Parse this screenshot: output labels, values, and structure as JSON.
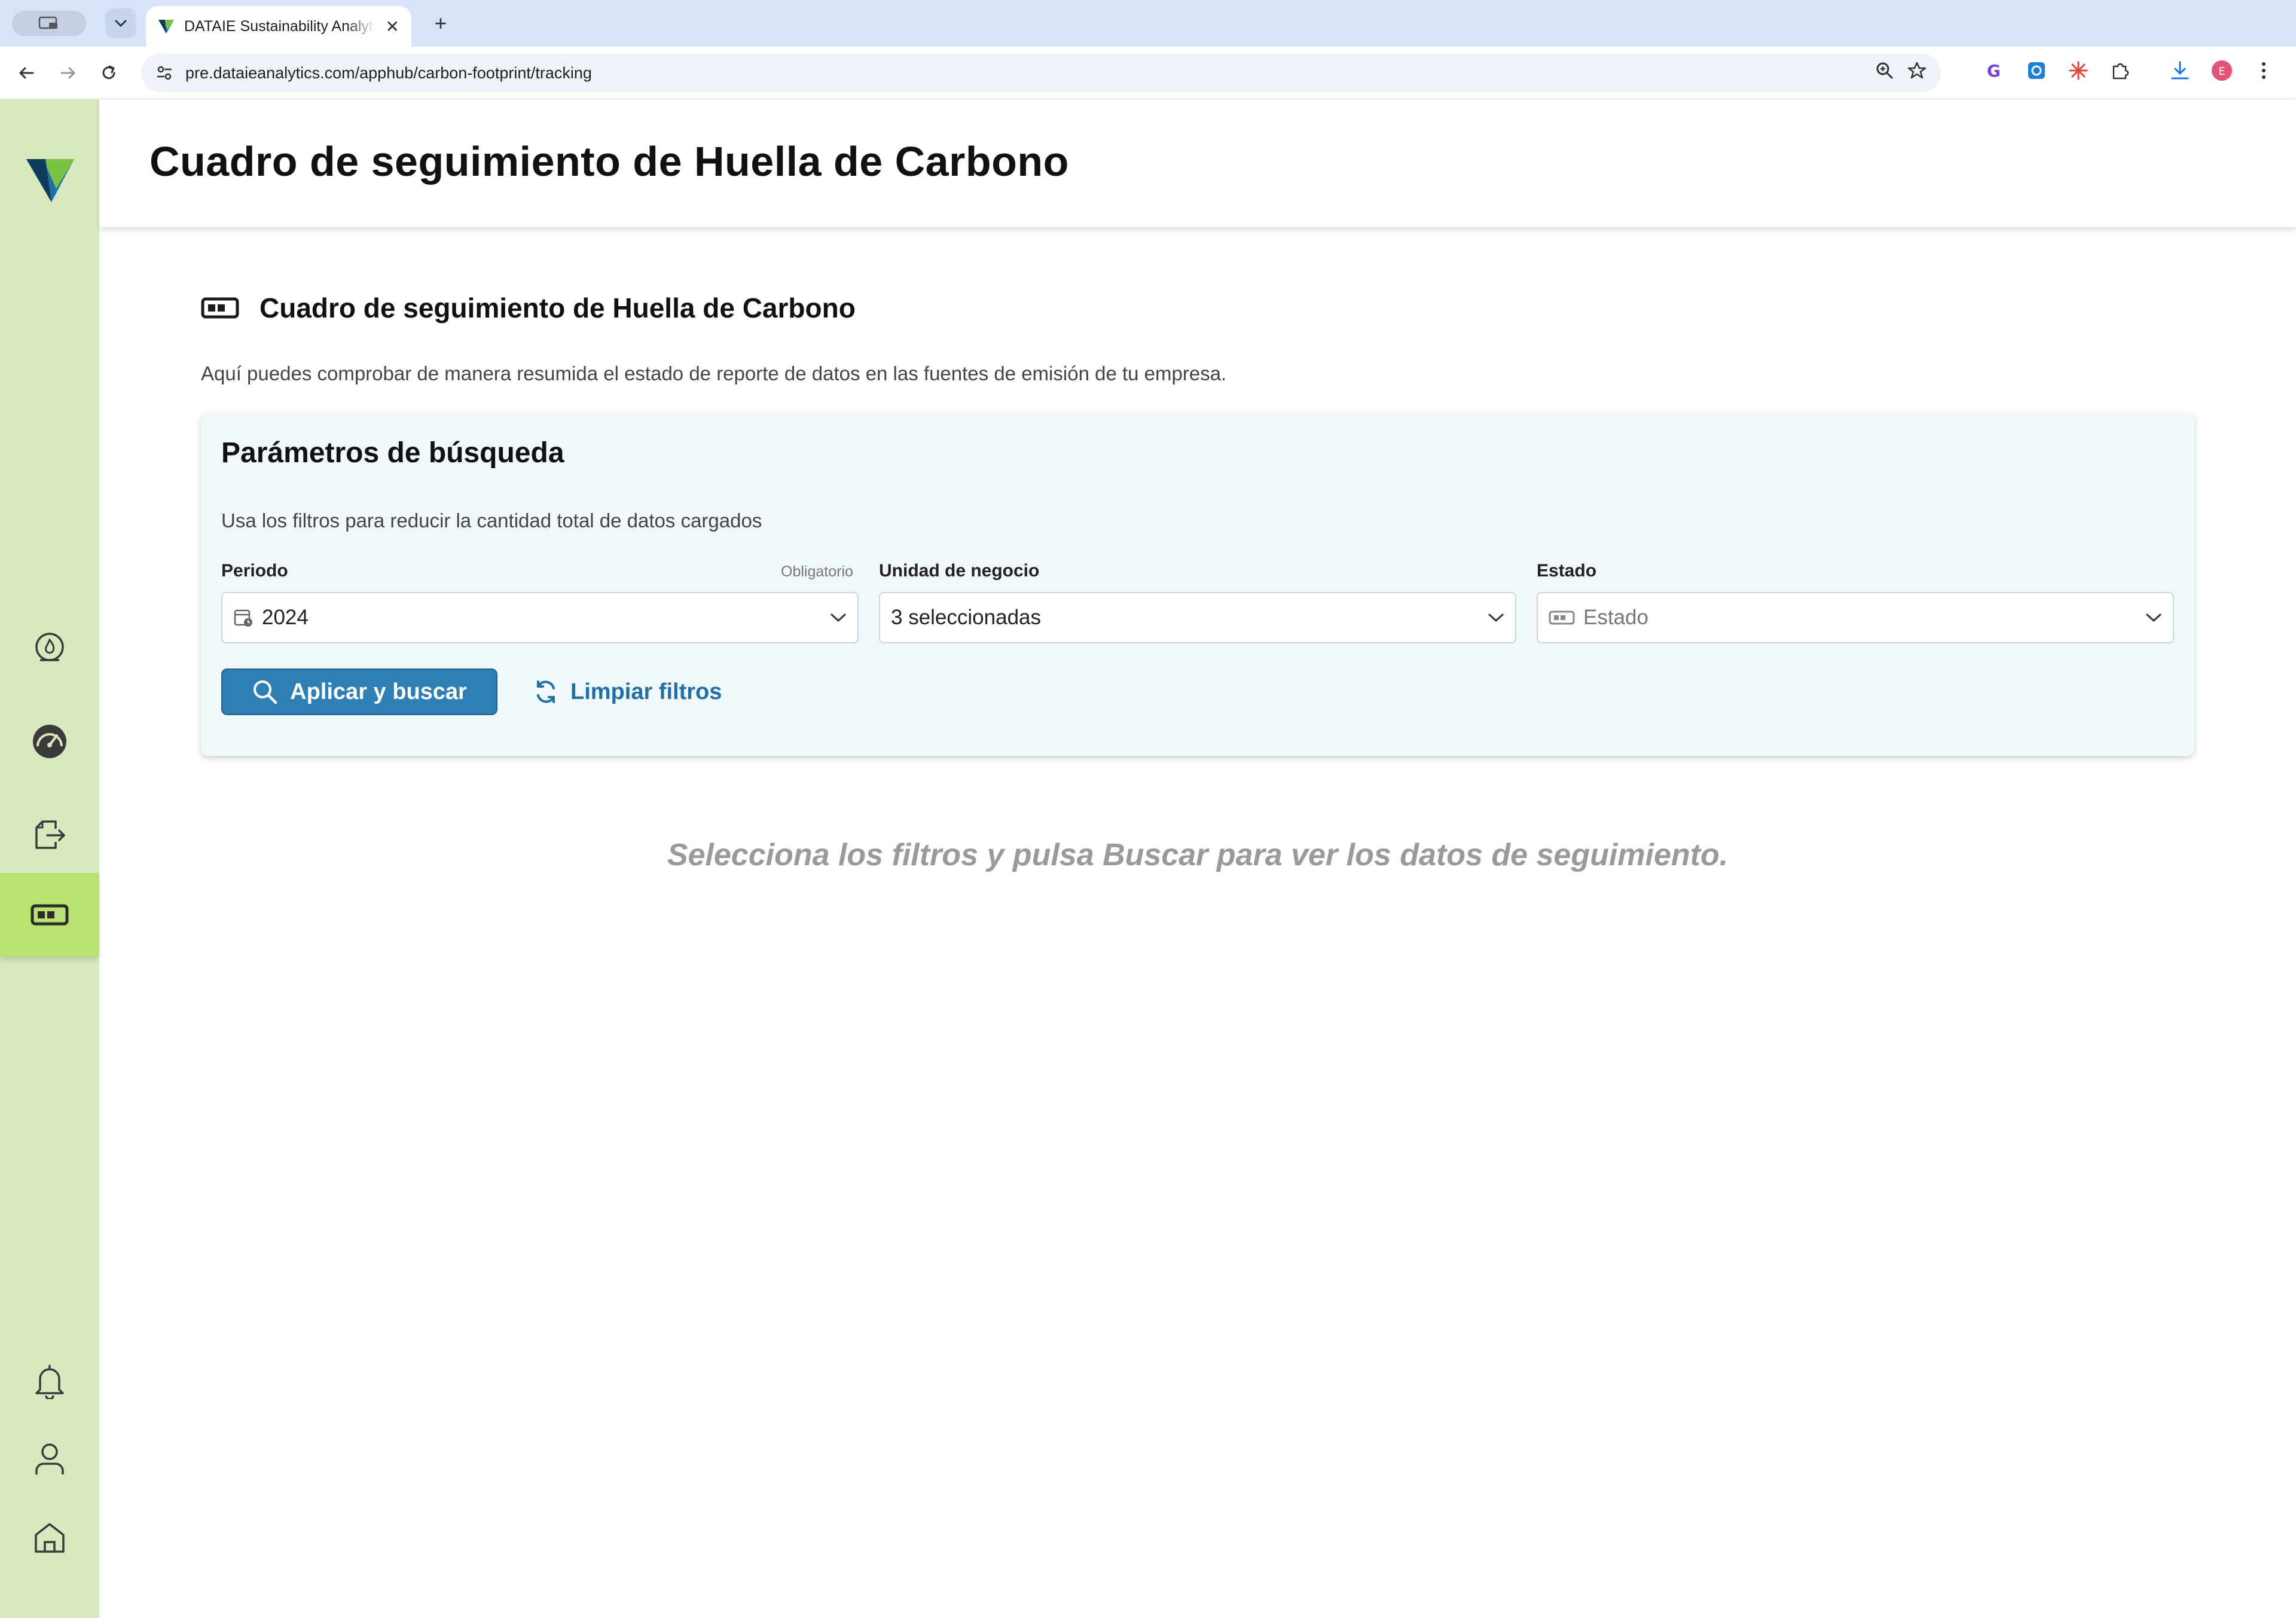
{
  "browser": {
    "tab_title": "DATAIE Sustainability Analytics",
    "url": "pre.dataieanalytics.com/apphub/carbon-footprint/tracking",
    "profile_initial": "E"
  },
  "header": {
    "title": "Cuadro de seguimiento de Huella de Carbono"
  },
  "section": {
    "title": "Cuadro de seguimiento de Huella de Carbono",
    "description": "Aquí puedes comprobar de manera resumida el estado de reporte de datos en las fuentes de emisión de tu empresa."
  },
  "filters": {
    "title": "Parámetros de búsqueda",
    "subtitle": "Usa los filtros para reducir la cantidad total de datos cargados",
    "periodo": {
      "label": "Periodo",
      "required_note": "Obligatorio",
      "value": "2024"
    },
    "unidad": {
      "label": "Unidad de negocio",
      "value": "3 seleccionadas"
    },
    "estado": {
      "label": "Estado",
      "placeholder": "Estado"
    },
    "apply_label": "Aplicar y buscar",
    "clear_label": "Limpiar filtros"
  },
  "empty_state": "Selecciona los filtros y pulsa Buscar para ver los datos de seguimiento.",
  "colors": {
    "sidebar_bg": "#d9e9bf",
    "sidebar_active": "#b8e272",
    "primary_button": "#2f7fb7",
    "card_bg": "#f0f8fc"
  },
  "sidebar_icons": [
    "flame-icon",
    "gauge-icon",
    "export-file-icon",
    "tracking-card-icon",
    "bell-icon",
    "user-icon",
    "home-icon"
  ]
}
